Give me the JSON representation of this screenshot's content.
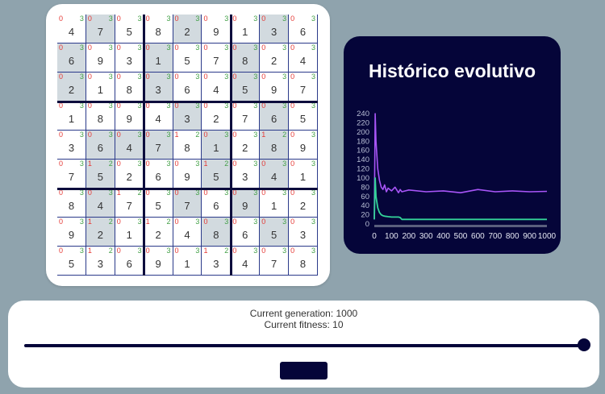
{
  "sudoku": {
    "values": [
      [
        4,
        7,
        5,
        8,
        2,
        9,
        1,
        3,
        6
      ],
      [
        6,
        9,
        3,
        1,
        5,
        7,
        8,
        2,
        4
      ],
      [
        2,
        1,
        8,
        3,
        6,
        4,
        5,
        9,
        7
      ],
      [
        1,
        8,
        9,
        4,
        3,
        2,
        7,
        6,
        5
      ],
      [
        3,
        6,
        4,
        7,
        8,
        1,
        2,
        8,
        9
      ],
      [
        7,
        5,
        2,
        6,
        9,
        5,
        3,
        4,
        1
      ],
      [
        8,
        4,
        7,
        5,
        7,
        6,
        9,
        1,
        2
      ],
      [
        9,
        2,
        1,
        2,
        4,
        8,
        6,
        5,
        3
      ],
      [
        5,
        3,
        6,
        9,
        1,
        3,
        4,
        7,
        8
      ]
    ],
    "left_counts": [
      [
        "0",
        "0",
        "0",
        "0",
        "0",
        "0",
        "0",
        "0",
        "0"
      ],
      [
        "0",
        "0",
        "0",
        "0",
        "0",
        "0",
        "0",
        "0",
        "0"
      ],
      [
        "0",
        "0",
        "0",
        "0",
        "0",
        "0",
        "0",
        "0",
        "0"
      ],
      [
        "0",
        "0",
        "0",
        "0",
        "0",
        "0",
        "0",
        "0",
        "0"
      ],
      [
        "0",
        "0",
        "0",
        "0",
        "1",
        "0",
        "0",
        "1",
        "0"
      ],
      [
        "0",
        "1",
        "0",
        "0",
        "0",
        "1",
        "0",
        "0",
        "0"
      ],
      [
        "0",
        "0",
        "1",
        "0",
        "0",
        "0",
        "0",
        "0",
        "0"
      ],
      [
        "0",
        "1",
        "0",
        "1",
        "0",
        "0",
        "0",
        "0",
        "0"
      ],
      [
        "0",
        "1",
        "0",
        "0",
        "0",
        "1",
        "0",
        "0",
        "0"
      ]
    ],
    "right_counts": [
      [
        "3",
        "3",
        "3",
        "3",
        "3",
        "3",
        "3",
        "3",
        "3"
      ],
      [
        "3",
        "3",
        "3",
        "3",
        "3",
        "3",
        "3",
        "3",
        "3"
      ],
      [
        "3",
        "3",
        "3",
        "3",
        "3",
        "3",
        "3",
        "3",
        "3"
      ],
      [
        "3",
        "3",
        "3",
        "3",
        "3",
        "3",
        "3",
        "3",
        "3"
      ],
      [
        "3",
        "3",
        "3",
        "3",
        "2",
        "3",
        "3",
        "2",
        "3"
      ],
      [
        "3",
        "2",
        "3",
        "3",
        "3",
        "2",
        "3",
        "3",
        "3"
      ],
      [
        "3",
        "3",
        "2",
        "3",
        "3",
        "3",
        "3",
        "3",
        "3"
      ],
      [
        "3",
        "2",
        "3",
        "2",
        "3",
        "3",
        "3",
        "3",
        "3"
      ],
      [
        "3",
        "2",
        "3",
        "3",
        "3",
        "2",
        "3",
        "3",
        "3"
      ]
    ],
    "shaded": [
      [
        1,
        4,
        7
      ],
      [
        0,
        3,
        6
      ],
      [
        0,
        3,
        6
      ],
      [
        4,
        7
      ],
      [
        1,
        2,
        3,
        5,
        7
      ],
      [
        1,
        5,
        7
      ],
      [
        1,
        4,
        6
      ],
      [
        1,
        5,
        7
      ],
      []
    ]
  },
  "history": {
    "title": "Histórico evolutivo",
    "colors": {
      "card": "#050539",
      "mutation": "#a855f7",
      "fitness": "#34d399",
      "axis": "#b9bfd6"
    }
  },
  "chart_data": {
    "type": "line",
    "title": "Histórico evolutivo",
    "xlabel": "",
    "ylabel": "",
    "x_ticks": [
      0,
      100,
      200,
      300,
      400,
      500,
      600,
      700,
      800,
      900,
      1000
    ],
    "y_ticks": [
      0,
      20,
      40,
      60,
      80,
      100,
      120,
      140,
      160,
      180,
      200,
      220,
      240
    ],
    "xlim": [
      0,
      1000
    ],
    "ylim": [
      0,
      240
    ],
    "series": [
      {
        "x": [
          0,
          5,
          10,
          20,
          30,
          40,
          50,
          60,
          70,
          80,
          100,
          120,
          140,
          150,
          160,
          200,
          300,
          400,
          500,
          600,
          700,
          800,
          900,
          1000
        ],
        "values": [
          10,
          240,
          180,
          120,
          95,
          80,
          75,
          85,
          70,
          78,
          72,
          80,
          68,
          75,
          70,
          74,
          70,
          72,
          68,
          75,
          70,
          72,
          70,
          71
        ]
      },
      {
        "x": [
          0,
          5,
          10,
          20,
          30,
          40,
          50,
          60,
          80,
          100,
          140,
          150,
          160,
          1000
        ],
        "values": [
          10,
          100,
          60,
          35,
          25,
          20,
          18,
          17,
          16,
          15,
          15,
          14,
          10,
          10
        ]
      }
    ]
  },
  "controls": {
    "generation_text": "Current generation: 1000",
    "fitness_text": "Current fitness: 10",
    "slider": {
      "min": 0,
      "max": 1000,
      "value": 1000
    },
    "button_label": ""
  }
}
